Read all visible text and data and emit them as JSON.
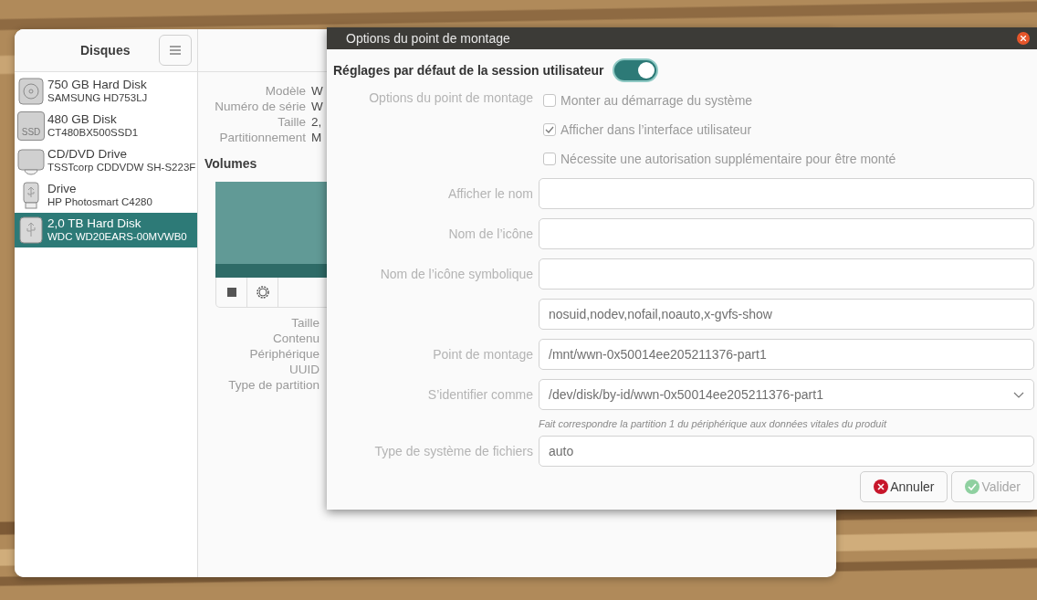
{
  "disks_window": {
    "title": "Disques",
    "disks": [
      {
        "kind": "hdd",
        "name": "750 GB Hard Disk",
        "model": "SAMSUNG HD753LJ",
        "selected": false
      },
      {
        "kind": "ssd",
        "badge": "SSD",
        "name": "480 GB Disk",
        "model": "CT480BX500SSD1",
        "selected": false
      },
      {
        "kind": "optical",
        "name": "CD/DVD Drive",
        "model": "TSSTcorp CDDVDW SH-S223F",
        "selected": false
      },
      {
        "kind": "usb-stick",
        "name": "Drive",
        "model": "HP Photosmart C4280",
        "selected": false
      },
      {
        "kind": "usb-disk",
        "name": "2,0 TB Hard Disk",
        "model": "WDC WD20EARS-00MVWB0",
        "selected": true
      }
    ],
    "drive_info": [
      {
        "label": "Modèle",
        "value": "W"
      },
      {
        "label": "Numéro de série",
        "value": "W"
      },
      {
        "label": "Taille",
        "value": "2,"
      },
      {
        "label": "Partitionnement",
        "value": "M"
      }
    ],
    "volumes_title": "Volumes",
    "volume_info": [
      "Taille",
      "Contenu",
      "Périphérique",
      "UUID",
      "Type de partition"
    ]
  },
  "dialog": {
    "title": "Options du point de montage",
    "toggle": {
      "label": "Réglages par défaut de la session utilisateur",
      "on": true
    },
    "options_label": "Options du point de montage",
    "checkboxes": [
      {
        "label": "Monter au démarrage du système",
        "checked": false
      },
      {
        "label": "Afficher dans l’interface utilisateur",
        "checked": true
      },
      {
        "label": "Nécessite une autorisation supplémentaire pour être monté",
        "checked": false
      }
    ],
    "fields": [
      {
        "kind": "text",
        "label": "Afficher le nom"
      },
      {
        "kind": "text",
        "label": "Nom de l’icône"
      },
      {
        "kind": "text",
        "label": "Nom de l’icône symbolique"
      },
      {
        "kind": "text",
        "value": "nosuid,nodev,nofail,noauto,x-gvfs-show"
      },
      {
        "kind": "text",
        "label": "Point de montage",
        "value": "/mnt/wwn-0x50014ee205211376-part1"
      },
      {
        "kind": "dropdown",
        "label": "S’identifier comme",
        "value": "/dev/disk/by-id/wwn-0x50014ee205211376-part1",
        "hint": "Fait correspondre la partition 1 du périphérique aux données vitales du produit"
      },
      {
        "kind": "text",
        "label": "Type de système de fichiers",
        "value": "auto"
      }
    ],
    "buttons": [
      {
        "kind": "cancel",
        "label": "Annuler",
        "disabled": false
      },
      {
        "kind": "ok",
        "label": "Valider",
        "disabled": true
      }
    ]
  }
}
